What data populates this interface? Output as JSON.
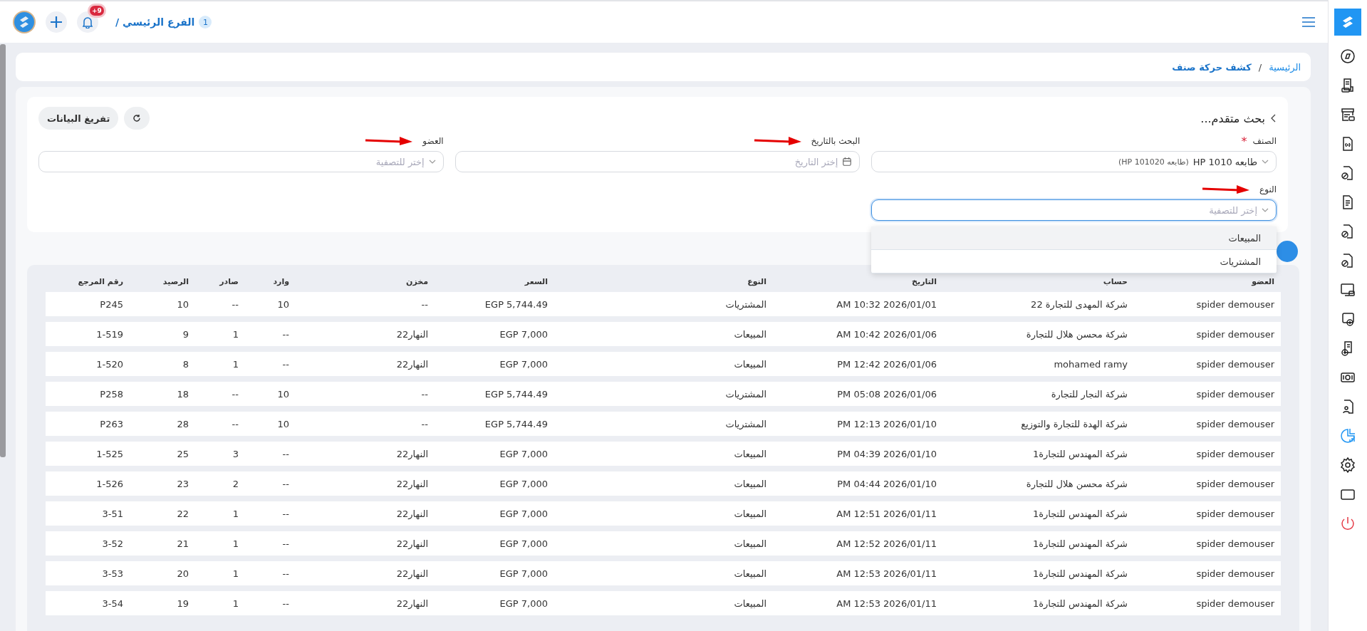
{
  "topbar": {
    "notification_badge": "+9",
    "branch_number": "1",
    "branch_name": "الفرع الرئيسي /"
  },
  "breadcrumb": {
    "home": "الرئيسية",
    "separator": "/",
    "current": "كشف حركة صنف"
  },
  "filters": {
    "title": "بحث متقدم...",
    "clear_button": "تفريغ البيانات",
    "fields": [
      {
        "kind": "select",
        "label": "الصنف",
        "required_mark": "*",
        "arrow": false,
        "value": "طابعه HP 1010",
        "value_detail": "(طابعه HP 101020)",
        "focused": false
      },
      {
        "kind": "date",
        "label": "البحث بالتاريخ",
        "arrow": true,
        "placeholder": "إختر التاريخ",
        "focused": false
      },
      {
        "kind": "select",
        "label": "العضو",
        "arrow": true,
        "placeholder": "إختر للتصفية",
        "focused": false
      },
      {
        "kind": "select",
        "label": "النوع",
        "arrow": true,
        "placeholder": "إختر للتصفية",
        "focused": true,
        "options": [
          {
            "label": "المبيعات",
            "highlighted": true
          },
          {
            "label": "المشتريات",
            "highlighted": false
          }
        ]
      }
    ]
  },
  "table": {
    "columns": [
      "العضو",
      "حساب",
      "التاريخ",
      "النوع",
      "السعر",
      "مخزن",
      "وارد",
      "صادر",
      "الرصيد",
      "رقم المرجع"
    ],
    "rows": [
      [
        "spider demouser",
        "شركة المهدى للتجارة 22",
        "AM 10:32 2026/01/01",
        "المشتريات",
        "EGP 5,744.49",
        "--",
        "10",
        "--",
        "10",
        "P245"
      ],
      [
        "spider demouser",
        "شركة محسن هلال للتجارة",
        "AM 10:42 2026/01/06",
        "المبيعات",
        "EGP 7,000",
        "النهار22",
        "--",
        "1",
        "9",
        "1-519"
      ],
      [
        "spider demouser",
        "mohamed ramy",
        "PM 12:42 2026/01/06",
        "المبيعات",
        "EGP 7,000",
        "النهار22",
        "--",
        "1",
        "8",
        "1-520"
      ],
      [
        "spider demouser",
        "شركة النجار للتجارة",
        "PM 05:08 2026/01/06",
        "المشتريات",
        "EGP 5,744.49",
        "--",
        "10",
        "--",
        "18",
        "P258"
      ],
      [
        "spider demouser",
        "شركة الهدة للتجارة والتوزيع",
        "PM 12:13 2026/01/10",
        "المشتريات",
        "EGP 5,744.49",
        "--",
        "10",
        "--",
        "28",
        "P263"
      ],
      [
        "spider demouser",
        "شركة المهندس للتجارة1",
        "PM 04:39 2026/01/10",
        "المبيعات",
        "EGP 7,000",
        "النهار22",
        "--",
        "3",
        "25",
        "1-525"
      ],
      [
        "spider demouser",
        "شركة محسن هلال للتجارة",
        "PM 04:44 2026/01/10",
        "المبيعات",
        "EGP 7,000",
        "النهار22",
        "--",
        "2",
        "23",
        "1-526"
      ],
      [
        "spider demouser",
        "شركة المهندس للتجارة1",
        "AM 12:51 2026/01/11",
        "المبيعات",
        "EGP 7,000",
        "النهار22",
        "--",
        "1",
        "22",
        "3-51"
      ],
      [
        "spider demouser",
        "شركة المهندس للتجارة1",
        "AM 12:52 2026/01/11",
        "المبيعات",
        "EGP 7,000",
        "النهار22",
        "--",
        "1",
        "21",
        "3-52"
      ],
      [
        "spider demouser",
        "شركة المهندس للتجارة1",
        "AM 12:53 2026/01/11",
        "المبيعات",
        "EGP 7,000",
        "النهار22",
        "--",
        "1",
        "20",
        "3-53"
      ],
      [
        "spider demouser",
        "شركة المهندس للتجارة1",
        "AM 12:53 2026/01/11",
        "المبيعات",
        "EGP 7,000",
        "النهار22",
        "--",
        "1",
        "19",
        "3-54"
      ]
    ]
  },
  "sidebar": {
    "items": [
      {
        "selected": false
      },
      {
        "selected": false
      },
      {
        "selected": false
      },
      {
        "selected": false
      },
      {
        "selected": false
      },
      {
        "selected": false
      },
      {
        "selected": false
      },
      {
        "selected": false
      },
      {
        "selected": false
      },
      {
        "selected": false
      },
      {
        "selected": false
      },
      {
        "selected": false
      },
      {
        "selected": false
      },
      {
        "selected": true
      },
      {
        "selected": false
      },
      {
        "selected": false
      },
      {
        "selected": false
      }
    ]
  }
}
